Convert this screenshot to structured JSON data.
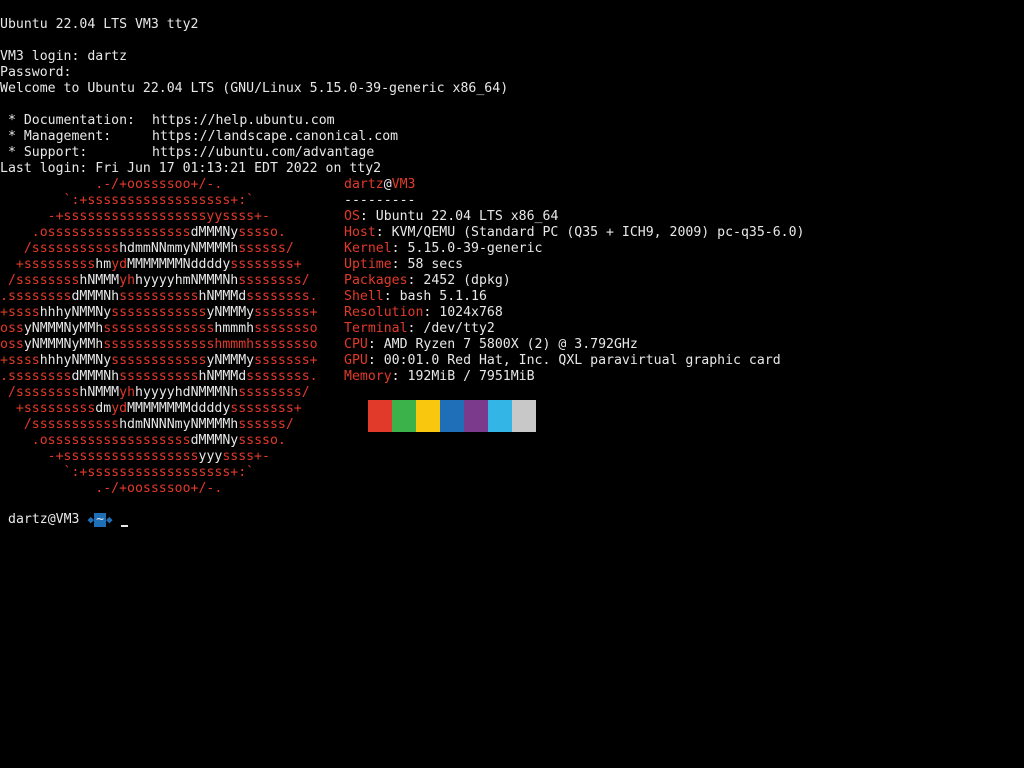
{
  "console": {
    "banner": "Ubuntu 22.04 LTS VM3 tty2",
    "login_line": "VM3 login: dartz",
    "password_line": "Password:",
    "welcome_line": "Welcome to Ubuntu 22.04 LTS (GNU/Linux 5.15.0-39-generic x86_64)",
    "links": [
      {
        "label": " * Documentation:",
        "url": "https://help.ubuntu.com"
      },
      {
        "label": " * Management:",
        "url": "https://landscape.canonical.com"
      },
      {
        "label": " * Support:",
        "url": "https://ubuntu.com/advantage"
      }
    ],
    "last_login": "Last login: Fri Jun 17 01:13:21 EDT 2022 on tty2"
  },
  "neofetch": {
    "user": "dartz",
    "at": "@",
    "host": "VM3",
    "separator": "---------",
    "fields": [
      {
        "key": "OS",
        "value": ": Ubuntu 22.04 LTS x86_64"
      },
      {
        "key": "Host",
        "value": ": KVM/QEMU (Standard PC (Q35 + ICH9, 2009) pc-q35-6.0)"
      },
      {
        "key": "Kernel",
        "value": ": 5.15.0-39-generic"
      },
      {
        "key": "Uptime",
        "value": ": 58 secs"
      },
      {
        "key": "Packages",
        "value": ": 2452 (dpkg)"
      },
      {
        "key": "Shell",
        "value": ": bash 5.1.16"
      },
      {
        "key": "Resolution",
        "value": ": 1024x768"
      },
      {
        "key": "Terminal",
        "value": ": /dev/tty2"
      },
      {
        "key": "CPU",
        "value": ": AMD Ryzen 7 5800X (2) @ 3.792GHz"
      },
      {
        "key": "GPU",
        "value": ": 00:01.0 Red Hat, Inc. QXL paravirtual graphic card"
      },
      {
        "key": "Memory",
        "value": ": 192MiB / 7951MiB"
      }
    ],
    "palette": [
      "#e23a2a",
      "#3cb34a",
      "#f9c80e",
      "#1f6fb8",
      "#7b3a8c",
      "#33b5e5",
      "#c8c8c8"
    ],
    "logo_lines": [
      [
        {
          "t": "            ",
          "c": "w"
        },
        {
          "t": ".-/+oossssoo+/-.",
          "c": "r"
        }
      ],
      [
        {
          "t": "        ",
          "c": "w"
        },
        {
          "t": "`:+ssssssssssssssssss+:`",
          "c": "r"
        }
      ],
      [
        {
          "t": "      ",
          "c": "w"
        },
        {
          "t": "-+ssssssssssssssssssyyssss+-",
          "c": "r"
        }
      ],
      [
        {
          "t": "    ",
          "c": "w"
        },
        {
          "t": ".ossssssssssssssssss",
          "c": "r"
        },
        {
          "t": "dMMMNy",
          "c": "w"
        },
        {
          "t": "sssso.",
          "c": "r"
        }
      ],
      [
        {
          "t": "   ",
          "c": "w"
        },
        {
          "t": "/sssssssssss",
          "c": "r"
        },
        {
          "t": "hdmmNNmmyNMMMMh",
          "c": "w"
        },
        {
          "t": "ssssss/",
          "c": "r"
        }
      ],
      [
        {
          "t": "  ",
          "c": "w"
        },
        {
          "t": "+sssssssss",
          "c": "r"
        },
        {
          "t": "hm",
          "c": "w"
        },
        {
          "t": "yd",
          "c": "r"
        },
        {
          "t": "MMMMMMMNddddy",
          "c": "w"
        },
        {
          "t": "ssssssss+",
          "c": "r"
        }
      ],
      [
        {
          "t": " ",
          "c": "w"
        },
        {
          "t": "/ssssssss",
          "c": "r"
        },
        {
          "t": "hNMMM",
          "c": "w"
        },
        {
          "t": "yh",
          "c": "r"
        },
        {
          "t": "hyyyyhmNMMMNh",
          "c": "w"
        },
        {
          "t": "ssssssss/",
          "c": "r"
        }
      ],
      [
        {
          "t": ".ssssssss",
          "c": "r"
        },
        {
          "t": "dMMMNh",
          "c": "w"
        },
        {
          "t": "ssssssssss",
          "c": "r"
        },
        {
          "t": "hNMMMd",
          "c": "w"
        },
        {
          "t": "ssssssss.",
          "c": "r"
        }
      ],
      [
        {
          "t": "+ssss",
          "c": "r"
        },
        {
          "t": "hhhyNMMNy",
          "c": "w"
        },
        {
          "t": "ssssssssssss",
          "c": "r"
        },
        {
          "t": "yNMMMy",
          "c": "w"
        },
        {
          "t": "sssssss+",
          "c": "r"
        }
      ],
      [
        {
          "t": "oss",
          "c": "r"
        },
        {
          "t": "yNMMMNyMMh",
          "c": "w"
        },
        {
          "t": "ssssssssssssss",
          "c": "r"
        },
        {
          "t": "hmmmh",
          "c": "w"
        },
        {
          "t": "ssssssso",
          "c": "r"
        }
      ],
      [
        {
          "t": "oss",
          "c": "r"
        },
        {
          "t": "yNMMMNyMMh",
          "c": "w"
        },
        {
          "t": "sssssssssssssshmmmhssssssso",
          "c": "r"
        }
      ],
      [
        {
          "t": "+ssss",
          "c": "r"
        },
        {
          "t": "hhhyNMMNy",
          "c": "w"
        },
        {
          "t": "ssssssssssss",
          "c": "r"
        },
        {
          "t": "yNMMMy",
          "c": "w"
        },
        {
          "t": "sssssss+",
          "c": "r"
        }
      ],
      [
        {
          "t": ".ssssssss",
          "c": "r"
        },
        {
          "t": "dMMMNh",
          "c": "w"
        },
        {
          "t": "ssssssssss",
          "c": "r"
        },
        {
          "t": "hNMMMd",
          "c": "w"
        },
        {
          "t": "ssssssss.",
          "c": "r"
        }
      ],
      [
        {
          "t": " ",
          "c": "w"
        },
        {
          "t": "/ssssssss",
          "c": "r"
        },
        {
          "t": "hNMMM",
          "c": "w"
        },
        {
          "t": "yh",
          "c": "r"
        },
        {
          "t": "hyyyyhdNMMMNh",
          "c": "w"
        },
        {
          "t": "ssssssss/",
          "c": "r"
        }
      ],
      [
        {
          "t": "  ",
          "c": "w"
        },
        {
          "t": "+sssssssss",
          "c": "r"
        },
        {
          "t": "dm",
          "c": "w"
        },
        {
          "t": "yd",
          "c": "r"
        },
        {
          "t": "MMMMMMMMddddy",
          "c": "w"
        },
        {
          "t": "ssssssss+",
          "c": "r"
        }
      ],
      [
        {
          "t": "   ",
          "c": "w"
        },
        {
          "t": "/sssssssssss",
          "c": "r"
        },
        {
          "t": "hdmNNNNmyNMMMMh",
          "c": "w"
        },
        {
          "t": "ssssss/",
          "c": "r"
        }
      ],
      [
        {
          "t": "    ",
          "c": "w"
        },
        {
          "t": ".ossssssssssssssssss",
          "c": "r"
        },
        {
          "t": "dMMMNy",
          "c": "w"
        },
        {
          "t": "sssso.",
          "c": "r"
        }
      ],
      [
        {
          "t": "      ",
          "c": "w"
        },
        {
          "t": "-+sssssssssssssssss",
          "c": "r"
        },
        {
          "t": "yyy",
          "c": "w"
        },
        {
          "t": "ssss+-",
          "c": "r"
        }
      ],
      [
        {
          "t": "        ",
          "c": "w"
        },
        {
          "t": "`:+ssssssssssssssssss+:`",
          "c": "r"
        }
      ],
      [
        {
          "t": "            ",
          "c": "w"
        },
        {
          "t": ".-/+oossssoo+/-.",
          "c": "r"
        }
      ]
    ]
  },
  "prompt": {
    "user_host": "dartz@VM3",
    "dir": "~"
  }
}
